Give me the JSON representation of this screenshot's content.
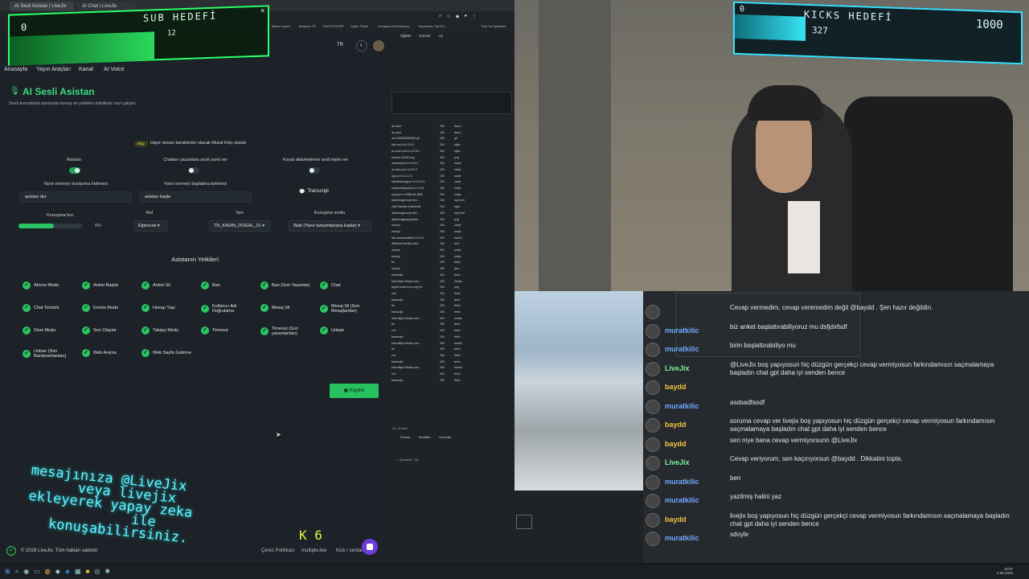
{
  "browser": {
    "tab1": "AI Sesli Asistan | LiveJix",
    "tab2": "AI Chat | LiveJix",
    "bookmarks": [
      "Batch Import",
      "Binance TR",
      "PHOTOSHOP",
      "Cyber Panel",
      "Lindsporod Workshop",
      "Yayıncılık | Twi Gö...",
      "Tüm Yer İşaretleri"
    ]
  },
  "sub_hud": {
    "title": "SUB HEDEFİ",
    "current": "0",
    "value": "12"
  },
  "kick_hud": {
    "title": "KICKS HEDEFİ",
    "current": "0",
    "target": "1000",
    "value": "327"
  },
  "app": {
    "nav": [
      "Anasayfa",
      "Yayın Araçları",
      "Kanal",
      "AI Voice"
    ],
    "lang": "TR",
    "title": "AI Sesli Asistan",
    "subtitle": "Sesli komutlarla asistanla konuş ve yetkileri dahilinde tool çalıştır.",
    "notice_badge": "Bilgi",
    "notice": "Hayır sessiz karakterler olacak Murat Kılıç olarak",
    "toggles": [
      {
        "label": "Asistan",
        "on": true
      },
      {
        "label": "Chatten yazanlara sesli yanıt ver",
        "on": false
      },
      {
        "label": "Kanal aktivitelerine sesli tepki ver",
        "on": false
      }
    ],
    "stop_word_label": "Yanıt vermeyi durdurma kelimesi",
    "stop_word": "asistan dur",
    "start_word_label": "Yanıt vermeyi başlatma kelimesi",
    "start_word": "asistan başla",
    "transcript": "Transcript",
    "speed_label": "Konuşma hızı",
    "speed_value": "5%",
    "speed": 0.55,
    "role_label": "Rol",
    "role": "Eğlenceli",
    "voice_label": "Ses",
    "voice": "TR_KADIN_DOGAL_01",
    "mode_label": "Konuşma modu",
    "mode": "Wait (Yanıt tamamlanana kadar)",
    "perms_title": "Asistanın Yetkileri",
    "perms": [
      "Abone Modu",
      "Anket Başlat",
      "Anket Sil",
      "Ban",
      "Ban (Son Yazanlar)",
      "Chat",
      "Chat Temizle",
      "Emote Modu",
      "Hesap Yaşı",
      "Kullanıcı Adı Doğrulama",
      "Mesaj Sil",
      "Mesaj Sil (Son Mesajlardan)",
      "Slow Modu",
      "Son Olaylar",
      "Takipçi Modu",
      "Timeout",
      "Timeout (Son yazanlardan)",
      "Unban",
      "Unban (Son Banlananlardan)",
      "Web Arama",
      "Web Sayfa Getirme"
    ],
    "save": "Kaydet",
    "footer": "© 2026 LiveJix. Tüm hakları saklıdır.",
    "footer_links": [
      "Çerez Politikası",
      "mutliple.live",
      "Kick / serdar..."
    ]
  },
  "devtools": {
    "tabs": [
      "Öğeler",
      "Konsol",
      "Ağ"
    ],
    "filter": "Filtre",
    "rows": [
      [
        "ai-voice",
        "200",
        "docu..."
      ],
      [
        "ai-voice",
        "200",
        "docu..."
      ],
      [
        "ad-12k6000024590.gif",
        "200",
        "gif"
      ],
      [
        "site.css?v=0.5.5.0",
        "304",
        "style..."
      ],
      [
        "ai-voice.css?v=0.5.5.0",
        "304",
        "style..."
      ],
      [
        "favicon-32x32.png",
        "304",
        "png"
      ],
      [
        "livestock.js?v=0.5.5.0",
        "200",
        "script"
      ],
      [
        "ai-voice.js?v=0.5.5.0",
        "200",
        "script"
      ],
      [
        "app.js?v=0.2.3.0",
        "200",
        "script"
      ],
      [
        "alertWarnings.js?v=0.5.5.0",
        "200",
        "script"
      ],
      [
        "sessionSignals.js?v=0.5.5",
        "200",
        "script"
      ],
      [
        "pubs.js?v=2988-5f1-8f99",
        "200",
        "script"
      ],
      [
        "data:image/svg+xml;...",
        "200",
        "svg+xml"
      ],
      [
        "css2?family=Audiowide",
        "200",
        "style..."
      ],
      [
        "data:image/svg+xml;...",
        "200",
        "svg+xml"
      ],
      [
        "data:image/png;base...",
        "200",
        "png"
      ],
      [
        "work.js",
        "200",
        "script"
      ],
      [
        "work.js",
        "200",
        "script"
      ],
      [
        "site-webmanifest?v=0.5.5",
        "200",
        "manif..."
      ],
      [
        "Webfont?family=Inter",
        "200",
        "font"
      ],
      [
        "work.js",
        "200",
        "script"
      ],
      [
        "work.js",
        "200",
        "script"
      ],
      [
        "tts",
        "200",
        "fetch"
      ],
      [
        "work.js",
        "200",
        "json"
      ],
      [
        "transcript",
        "200",
        "fetch"
      ],
      [
        "blob:https://livejix.com...",
        "200",
        "media"
      ],
      [
        "apple-touch-icon.png?v1",
        "304",
        "png"
      ],
      [
        "eve",
        "200",
        "fetch"
      ],
      [
        "transcript",
        "200",
        "fetch"
      ],
      [
        "tts",
        "200",
        "fetch"
      ],
      [
        "transcript",
        "200",
        "fetch"
      ],
      [
        "blob:https://livejix.com...",
        "200",
        "media"
      ],
      [
        "tts",
        "200",
        "fetch"
      ],
      [
        "eve",
        "200",
        "fetch"
      ],
      [
        "transcript",
        "200",
        "fetch"
      ],
      [
        "blob:https://livejix.com...",
        "200",
        "media"
      ],
      [
        "tts",
        "200",
        "fetch"
      ],
      [
        "eve",
        "200",
        "fetch"
      ],
      [
        "transcript",
        "200",
        "fetch"
      ],
      [
        "blob:https://livejix.com...",
        "200",
        "media"
      ],
      [
        "eve",
        "200",
        "fetch"
      ],
      [
        "transcript",
        "200",
        "fetch"
      ]
    ],
    "status_line": "42 / 42 istek",
    "console_tabs": [
      "Konsol",
      "Yenilikler",
      "Sorunlar"
    ],
    "console_line": "> {'version': '8'}"
  },
  "chat": [
    {
      "user": "",
      "msg": "Cevap vermedim, cevap veremedim değil @baydd . Şen hazır değildin."
    },
    {
      "user": "muratkilic",
      "msg": "biz anket başlattırabiliyoruz mu dsfjdxfsdf"
    },
    {
      "user": "muratkilic",
      "msg": "birin başlattırabiliyo mu"
    },
    {
      "user": "LiveJix",
      "msg": "@LiveJix boş yapıyosun hiç düzgün gerçekçi cevap vermiyosun farkındamısın saçmalamaya başladın chat gpt daha iyi senden bence"
    },
    {
      "user": "baydd",
      "msg": ""
    },
    {
      "user": "muratkilic",
      "msg": "asdsadfasdf"
    },
    {
      "user": "baydd",
      "msg": "soruma cevap ver livejix boş yapıyosun hiç düzgün gerçekçi cevap vermiyosun farkındamısın saçmalamaya başladın chat gpt daha iyi senden bence"
    },
    {
      "user": "baydd",
      "msg": "sen niye bana cevap vermiyorsunn @LiveJix"
    },
    {
      "user": "LiveJix",
      "msg": "Cevap veriyorum, sen kaçırıyorsun @baydd . Dikkatini topla."
    },
    {
      "user": "muratkilic",
      "msg": "ben"
    },
    {
      "user": "muratkilic",
      "msg": "yazilmiş halini yaz"
    },
    {
      "user": "baydd",
      "msg": "livejix boş yapıyosun hiç düzgün gerçekçi cevap vermiyosun farkındamısın saçmalamaya başladın chat gpt daha iyi senden bence"
    },
    {
      "user": "muratkilic",
      "msg": "sdoyle"
    }
  ],
  "overlay": {
    "line1": "mesajınıza @LiveJix",
    "line2": "veya livejix",
    "line3": "ekleyerek yapay zeka",
    "line4": "ile",
    "line5": "konuşabilirsiniz.",
    "counter": "K 6"
  },
  "taskbar": {
    "time": "19:07",
    "date": "4.05.2026"
  }
}
